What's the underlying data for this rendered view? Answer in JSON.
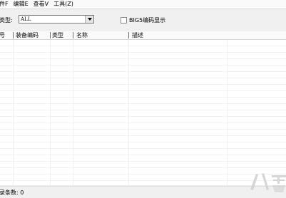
{
  "menubar": {
    "items": [
      "件F",
      "编辑E",
      "查看V",
      "工具(Z)"
    ]
  },
  "toolbar": {
    "type_label": "类型:",
    "type_select_value": "ALL",
    "big5_label": "BIG5编码显示",
    "big5_checked": false
  },
  "table": {
    "columns": [
      "号",
      "装备编码",
      "类型",
      "名称",
      "描述"
    ]
  },
  "statusbar": {
    "text": "录条数: 0"
  },
  "watermark": {
    "text": "八零"
  },
  "colors": {
    "window_bg": "#f0f0f0",
    "grid_bg": "#ffffff",
    "grid_line": "#f1f1f1"
  }
}
